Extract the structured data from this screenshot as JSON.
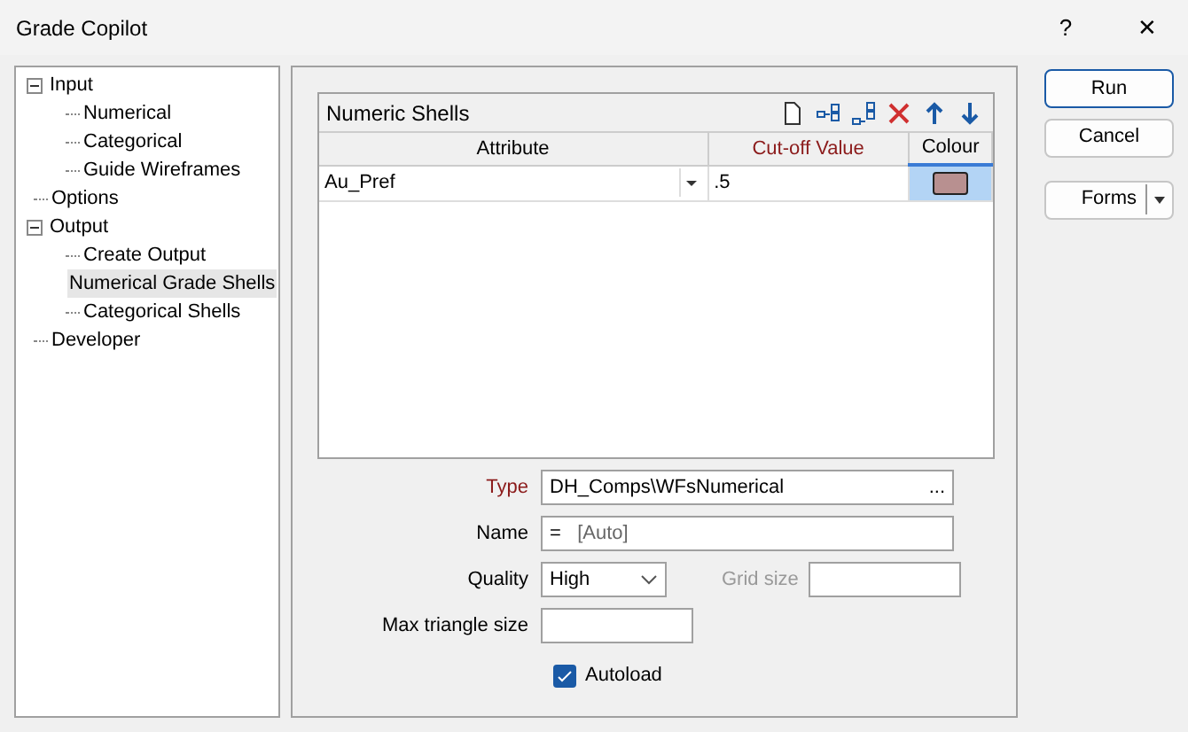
{
  "window": {
    "title": "Grade Copilot",
    "help": "?",
    "close": "✕"
  },
  "tree": [
    {
      "label": "Input",
      "expanded": true,
      "selected": false,
      "children": [
        {
          "label": "Numerical",
          "selected": false
        },
        {
          "label": "Categorical",
          "selected": false
        },
        {
          "label": "Guide Wireframes",
          "selected": false
        }
      ]
    },
    {
      "label": "Options",
      "selected": false
    },
    {
      "label": "Output",
      "expanded": true,
      "selected": false,
      "children": [
        {
          "label": "Create Output",
          "selected": false
        },
        {
          "label": "Numerical Grade Shells",
          "selected": true
        },
        {
          "label": "Categorical Shells",
          "selected": false
        }
      ]
    },
    {
      "label": "Developer",
      "selected": false
    }
  ],
  "grid": {
    "title": "Numeric Shells",
    "columns": [
      "Attribute",
      "Cut-off Value",
      "Colour"
    ],
    "rows": [
      {
        "attribute": "Au_Pref",
        "cutoff": ".5",
        "color": "#b89090",
        "selected": true
      }
    ]
  },
  "form": {
    "type_label": "Type",
    "type_value": "DH_Comps\\WFsNumerical",
    "browse": "...",
    "name_label": "Name",
    "name_prefix": "=",
    "name_value": "[Auto]",
    "quality_label": "Quality",
    "quality_value": "High",
    "grid_size_label": "Grid size",
    "max_label": "Max triangle size",
    "autoload": {
      "label": "Autoload",
      "checked": true
    }
  },
  "buttons": {
    "run": "Run",
    "cancel": "Cancel",
    "forms": "Forms"
  }
}
